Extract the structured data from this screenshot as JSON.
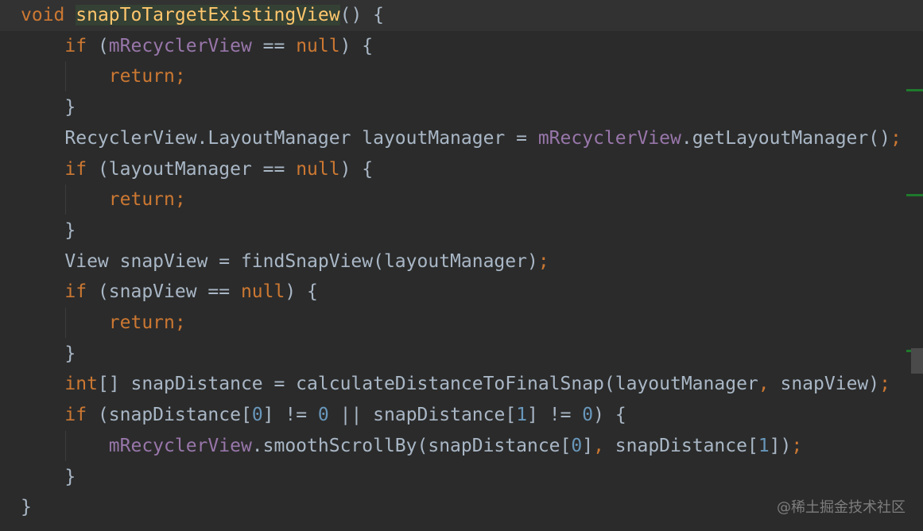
{
  "editor": {
    "lines": [
      [
        {
          "t": "void ",
          "c": "kw"
        },
        {
          "t": "snapToTargetExistingView",
          "c": "fn hl"
        },
        {
          "t": "() {",
          "c": "pl"
        }
      ],
      [
        {
          "t": "    if ",
          "c": "kw"
        },
        {
          "t": "(",
          "c": "pl"
        },
        {
          "t": "mRecyclerView",
          "c": "fld"
        },
        {
          "t": " == ",
          "c": "pl"
        },
        {
          "t": "null",
          "c": "kw"
        },
        {
          "t": ") {",
          "c": "pl"
        }
      ],
      [
        {
          "t": "        return;",
          "c": "kw"
        }
      ],
      [
        {
          "t": "    }",
          "c": "pl"
        }
      ],
      [
        {
          "t": "    RecyclerView.LayoutManager layoutManager = ",
          "c": "pl"
        },
        {
          "t": "mRecyclerView",
          "c": "fld"
        },
        {
          "t": ".getLayoutManager()",
          "c": "pl"
        },
        {
          "t": ";",
          "c": "kw"
        }
      ],
      [
        {
          "t": "    if ",
          "c": "kw"
        },
        {
          "t": "(layoutManager == ",
          "c": "pl"
        },
        {
          "t": "null",
          "c": "kw"
        },
        {
          "t": ") {",
          "c": "pl"
        }
      ],
      [
        {
          "t": "        return;",
          "c": "kw"
        }
      ],
      [
        {
          "t": "    }",
          "c": "pl"
        }
      ],
      [
        {
          "t": "    View snapView = findSnapView(layoutManager)",
          "c": "pl"
        },
        {
          "t": ";",
          "c": "kw"
        }
      ],
      [
        {
          "t": "    if ",
          "c": "kw"
        },
        {
          "t": "(snapView == ",
          "c": "pl"
        },
        {
          "t": "null",
          "c": "kw"
        },
        {
          "t": ") {",
          "c": "pl"
        }
      ],
      [
        {
          "t": "        return;",
          "c": "kw"
        }
      ],
      [
        {
          "t": "    }",
          "c": "pl"
        }
      ],
      [
        {
          "t": "    int",
          "c": "kw"
        },
        {
          "t": "[] snapDistance = calculateDistanceToFinalSnap(layoutManager",
          "c": "pl"
        },
        {
          "t": ", ",
          "c": "kw"
        },
        {
          "t": "snapView)",
          "c": "pl"
        },
        {
          "t": ";",
          "c": "kw"
        }
      ],
      [
        {
          "t": "    if ",
          "c": "kw"
        },
        {
          "t": "(snapDistance[",
          "c": "pl"
        },
        {
          "t": "0",
          "c": "num"
        },
        {
          "t": "] != ",
          "c": "pl"
        },
        {
          "t": "0",
          "c": "num"
        },
        {
          "t": " || snapDistance[",
          "c": "pl"
        },
        {
          "t": "1",
          "c": "num"
        },
        {
          "t": "] != ",
          "c": "pl"
        },
        {
          "t": "0",
          "c": "num"
        },
        {
          "t": ") {",
          "c": "pl"
        }
      ],
      [
        {
          "t": "        ",
          "c": "pl"
        },
        {
          "t": "mRecyclerView",
          "c": "fld"
        },
        {
          "t": ".smoothScrollBy(snapDistance[",
          "c": "pl"
        },
        {
          "t": "0",
          "c": "num"
        },
        {
          "t": "]",
          "c": "pl"
        },
        {
          "t": ", ",
          "c": "kw"
        },
        {
          "t": "snapDistance[",
          "c": "pl"
        },
        {
          "t": "1",
          "c": "num"
        },
        {
          "t": "])",
          "c": "pl"
        },
        {
          "t": ";",
          "c": "kw"
        }
      ],
      [
        {
          "t": "    }",
          "c": "pl"
        }
      ],
      [
        {
          "t": "}",
          "c": "pl"
        }
      ]
    ]
  },
  "colors": {
    "background": "#2b2b2b",
    "keyword": "#cc7832",
    "method_declaration": "#ffc66d",
    "field": "#9876aa",
    "number": "#6897bb",
    "plain": "#a9b7c6"
  },
  "watermark": "@稀土掘金技术社区"
}
